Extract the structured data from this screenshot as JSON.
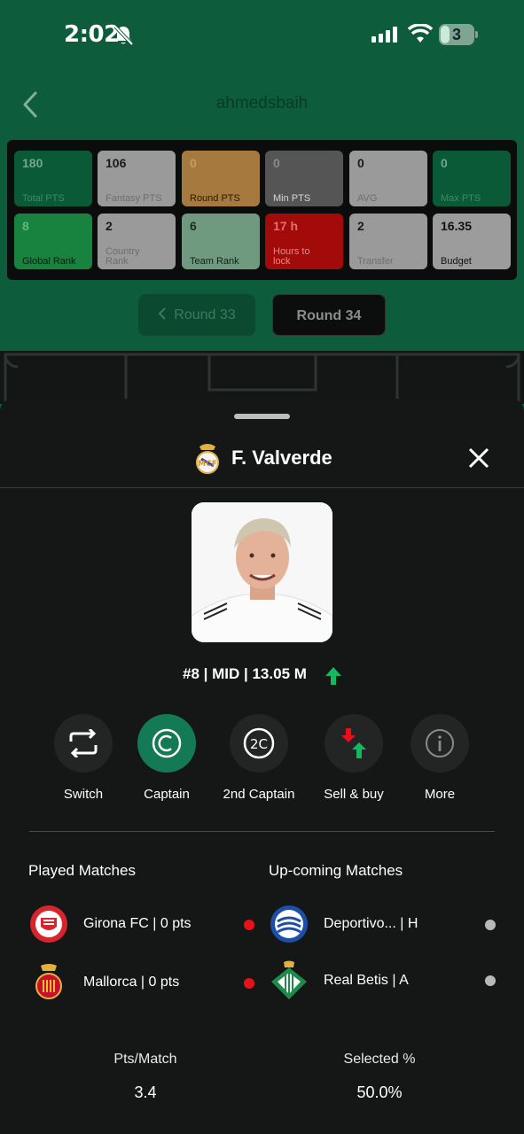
{
  "status_bar": {
    "time": "2:02",
    "battery": "3"
  },
  "header": {
    "username": "ahmedsbaih"
  },
  "stats": [
    {
      "value": "180",
      "label": "Total PTS",
      "style": "green"
    },
    {
      "value": "106",
      "label": "Fantasy PTS",
      "style": "grey"
    },
    {
      "value": "0",
      "label": "Round PTS",
      "style": "orange"
    },
    {
      "value": "0",
      "label": "Min PTS",
      "style": "dgrey"
    },
    {
      "value": "0",
      "label": "AVG",
      "style": "grey"
    },
    {
      "value": "0",
      "label": "Max PTS",
      "style": "green"
    },
    {
      "value": "8",
      "label": "Global Rank",
      "style": "bgreen"
    },
    {
      "value": "2",
      "label": "Country Rank",
      "style": "grey"
    },
    {
      "value": "6",
      "label": "Team Rank",
      "style": "mgreen"
    },
    {
      "value": "17 h",
      "label": "Hours to lock",
      "style": "red"
    },
    {
      "value": "2",
      "label": "Transfer",
      "style": "grey"
    },
    {
      "value": "16.35",
      "label": "Budget",
      "style": "budget"
    }
  ],
  "rounds": {
    "prev": "Round 33",
    "current": "Round 34"
  },
  "player": {
    "name": "F. Valverde",
    "meta": "#8 | MID | 13.05 M",
    "price_trend": "up"
  },
  "actions": [
    {
      "label": "Switch",
      "icon": "switch-icon",
      "active": false
    },
    {
      "label": "Captain",
      "icon": "captain-icon",
      "active": true
    },
    {
      "label": "2nd Captain",
      "icon": "second-captain-icon",
      "active": false
    },
    {
      "label": "Sell & buy",
      "icon": "sell-buy-icon",
      "active": false
    },
    {
      "label": "More",
      "icon": "info-icon",
      "active": false
    }
  ],
  "played": {
    "title": "Played Matches",
    "matches": [
      {
        "text": "Girona FC | 0 pts",
        "crest": "girona-crest",
        "status_color": "#e8111a"
      },
      {
        "text": "Mallorca | 0 pts",
        "crest": "mallorca-crest",
        "status_color": "#e8111a"
      }
    ]
  },
  "upcoming": {
    "title": "Up-coming Matches",
    "matches": [
      {
        "text": "Deportivo... | H",
        "crest": "alaves-crest",
        "status_color": "#b8b8b8"
      },
      {
        "text": "Real Betis | A",
        "crest": "betis-crest",
        "status_color": "#b8b8b8"
      }
    ]
  },
  "summary": {
    "pts_label": "Pts/Match",
    "pts_value": "3.4",
    "selected_label": "Selected %",
    "selected_value": "50.0%"
  }
}
